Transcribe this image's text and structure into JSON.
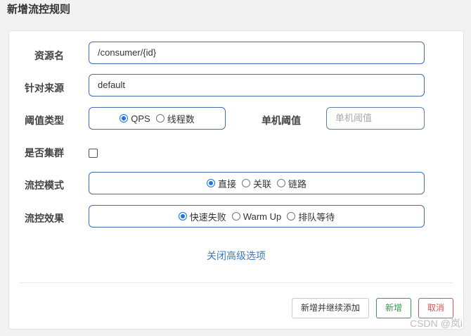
{
  "dialog": {
    "title": "新增流控规则",
    "close_glyph": "^"
  },
  "form": {
    "resource": {
      "label": "资源名",
      "value": "/consumer/{id}"
    },
    "limit_app": {
      "label": "针对来源",
      "value": "default"
    },
    "grade": {
      "label": "阈值类型",
      "options": [
        "QPS",
        "线程数"
      ],
      "selected": "QPS"
    },
    "threshold": {
      "label": "单机阈值",
      "placeholder": "单机阈值"
    },
    "cluster": {
      "label": "是否集群",
      "checked": false
    },
    "strategy": {
      "label": "流控模式",
      "options": [
        "直接",
        "关联",
        "链路"
      ],
      "selected": "直接"
    },
    "control_behavior": {
      "label": "流控效果",
      "options": [
        "快速失败",
        "Warm Up",
        "排队等待"
      ],
      "selected": "快速失败"
    },
    "advanced_link": "关闭高级选项"
  },
  "footer": {
    "continue_label": "新增并继续添加",
    "add_label": "新增",
    "cancel_label": "取消"
  },
  "watermark": "CSDN @岚i",
  "colors": {
    "input_border": "#3f6fb0",
    "radio_selected": "#1a73e8",
    "link": "#3a7bbf",
    "add_green": "#2e9e4f",
    "cancel_red": "#d9534f"
  }
}
